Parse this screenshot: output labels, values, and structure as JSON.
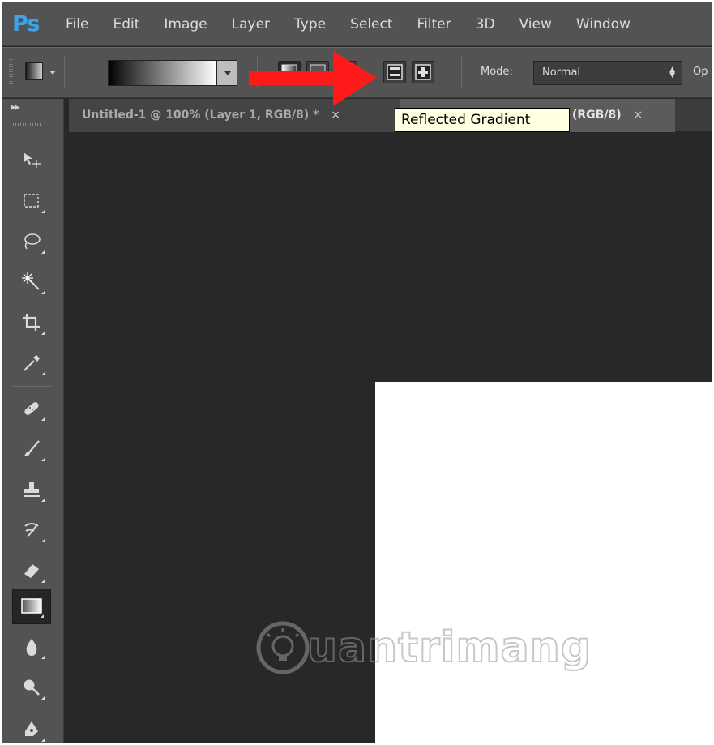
{
  "app": {
    "logo": "Ps"
  },
  "menu": {
    "items": [
      "File",
      "Edit",
      "Image",
      "Layer",
      "Type",
      "Select",
      "Filter",
      "3D",
      "View",
      "Window"
    ]
  },
  "options_bar": {
    "mode_label": "Mode:",
    "mode_value": "Normal",
    "opacity_label": "Op",
    "gradient_types": [
      "linear-gradient-icon",
      "radial-gradient-icon",
      "angle-gradient-icon",
      "reflected-gradient-icon",
      "diamond-gradient-icon"
    ]
  },
  "tabs": [
    {
      "label": "Untitled-1 @ 100% (Layer 1, RGB/8) *",
      "close": "×"
    },
    {
      "label": "(RGB/8)",
      "close": "×"
    }
  ],
  "tooltip": {
    "text": "Reflected Gradient"
  },
  "tools": [
    "move-tool-icon",
    "marquee-tool-icon",
    "lasso-tool-icon",
    "magic-wand-tool-icon",
    "crop-tool-icon",
    "eyedropper-tool-icon",
    "healing-brush-tool-icon",
    "brush-tool-icon",
    "clone-stamp-tool-icon",
    "history-brush-tool-icon",
    "eraser-tool-icon",
    "gradient-tool-icon",
    "blur-tool-icon",
    "dodge-tool-icon",
    "pen-tool-icon"
  ],
  "active_tool": "gradient-tool-icon",
  "watermark": {
    "text": "uantrimang"
  },
  "colors": {
    "logo": "#3ea3e6",
    "annotation_arrow": "#ff0000",
    "tooltip_bg": "#ffffe1",
    "panel_bg": "#535353",
    "workspace_bg": "#282828"
  }
}
